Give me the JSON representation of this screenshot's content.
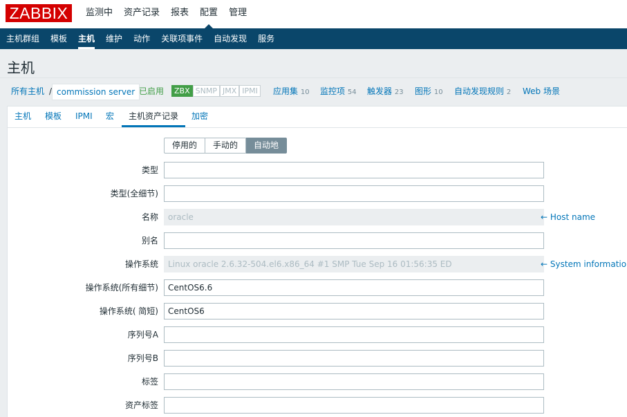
{
  "app": {
    "logo": "ZABBIX"
  },
  "topnav": [
    {
      "label": "监测中"
    },
    {
      "label": "资产记录"
    },
    {
      "label": "报表"
    },
    {
      "label": "配置"
    },
    {
      "label": "管理"
    }
  ],
  "topnav_active": "配置",
  "subnav": [
    {
      "label": "主机群组"
    },
    {
      "label": "模板"
    },
    {
      "label": "主机"
    },
    {
      "label": "维护"
    },
    {
      "label": "动作"
    },
    {
      "label": "关联项事件"
    },
    {
      "label": "自动发现"
    },
    {
      "label": "服务"
    }
  ],
  "subnav_active": "主机",
  "page": {
    "title": "主机"
  },
  "breadcrumb": {
    "all_hosts": "所有主机",
    "separator": "/",
    "current_host": "commission server",
    "status": "已启用",
    "availability": [
      "ZBX",
      "SNMP",
      "JMX",
      "IPMI"
    ],
    "links": [
      {
        "label": "应用集",
        "count": "10"
      },
      {
        "label": "监控项",
        "count": "54"
      },
      {
        "label": "触发器",
        "count": "23"
      },
      {
        "label": "图形",
        "count": "10"
      },
      {
        "label": "自动发现规则",
        "count": "2"
      },
      {
        "label": "Web 场景",
        "count": ""
      }
    ]
  },
  "tabs": [
    {
      "label": "主机"
    },
    {
      "label": "模板"
    },
    {
      "label": "IPMI"
    },
    {
      "label": "宏"
    },
    {
      "label": "主机资产记录"
    },
    {
      "label": "加密"
    }
  ],
  "tabs_active": "主机资产记录",
  "inventory_mode": {
    "options": [
      "停用的",
      "手动的",
      "自动地"
    ],
    "selected": "自动地"
  },
  "fields": [
    {
      "label": "类型",
      "value": "",
      "readonly": false,
      "hint": ""
    },
    {
      "label": "类型(全细节)",
      "value": "",
      "readonly": false,
      "hint": ""
    },
    {
      "label": "名称",
      "value": "oracle",
      "readonly": true,
      "hint": "← Host name"
    },
    {
      "label": "别名",
      "value": "",
      "readonly": false,
      "hint": ""
    },
    {
      "label": "操作系统",
      "value": "Linux oracle 2.6.32-504.el6.x86_64 #1 SMP Tue Sep 16 01:56:35 ED",
      "readonly": true,
      "hint": "← System information"
    },
    {
      "label": "操作系统(所有细节)",
      "value": "CentOS6.6",
      "readonly": false,
      "hint": ""
    },
    {
      "label": "操作系统( 简短)",
      "value": "CentOS6",
      "readonly": false,
      "hint": ""
    },
    {
      "label": "序列号A",
      "value": "",
      "readonly": false,
      "hint": ""
    },
    {
      "label": "序列号B",
      "value": "",
      "readonly": false,
      "hint": ""
    },
    {
      "label": "标签",
      "value": "",
      "readonly": false,
      "hint": ""
    },
    {
      "label": "资产标签",
      "value": "",
      "readonly": false,
      "hint": ""
    }
  ],
  "colors": {
    "logo_red": "#d40000",
    "nav_blue": "#0a466a",
    "link_blue": "#0275b8",
    "enabled_green": "#429e47"
  }
}
